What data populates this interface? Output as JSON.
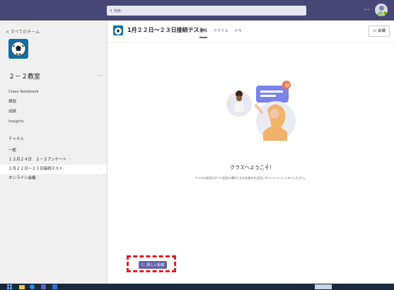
{
  "search": {
    "placeholder": "検索"
  },
  "top": {
    "more_label": "…"
  },
  "sidebar": {
    "back_label": "< すべてのチーム",
    "team_name": "２－２教室",
    "more_label": "…",
    "links": [
      "Class Notebook",
      "課題",
      "成績",
      "Insights"
    ],
    "channels_header": "チャネル",
    "channels": [
      {
        "label": "一般"
      },
      {
        "label": "１２月２４日　２－２アンケート"
      },
      {
        "label": "１月２２日～２３日接続テスト",
        "active": true,
        "more": "…"
      },
      {
        "label": "オンライン会議"
      }
    ]
  },
  "header": {
    "title": "1月２２日～２３日接続テスト",
    "tabs": [
      {
        "label": "投稿",
        "active": true
      },
      {
        "label": "ファイル"
      },
      {
        "label": "メモ"
      }
    ],
    "meet_label": "会議",
    "meet_icon": "video-camera-icon"
  },
  "main": {
    "welcome_title": "クラスへようこそ!",
    "welcome_sub": "クラスの会話はすべて会話の場所となる仕組みを会話にボメンションしてみてください。",
    "new_post_label": "新しい投稿"
  },
  "colors": {
    "accent": "#6264a7",
    "topbar": "#464775",
    "highlight": "#e31c1c"
  }
}
